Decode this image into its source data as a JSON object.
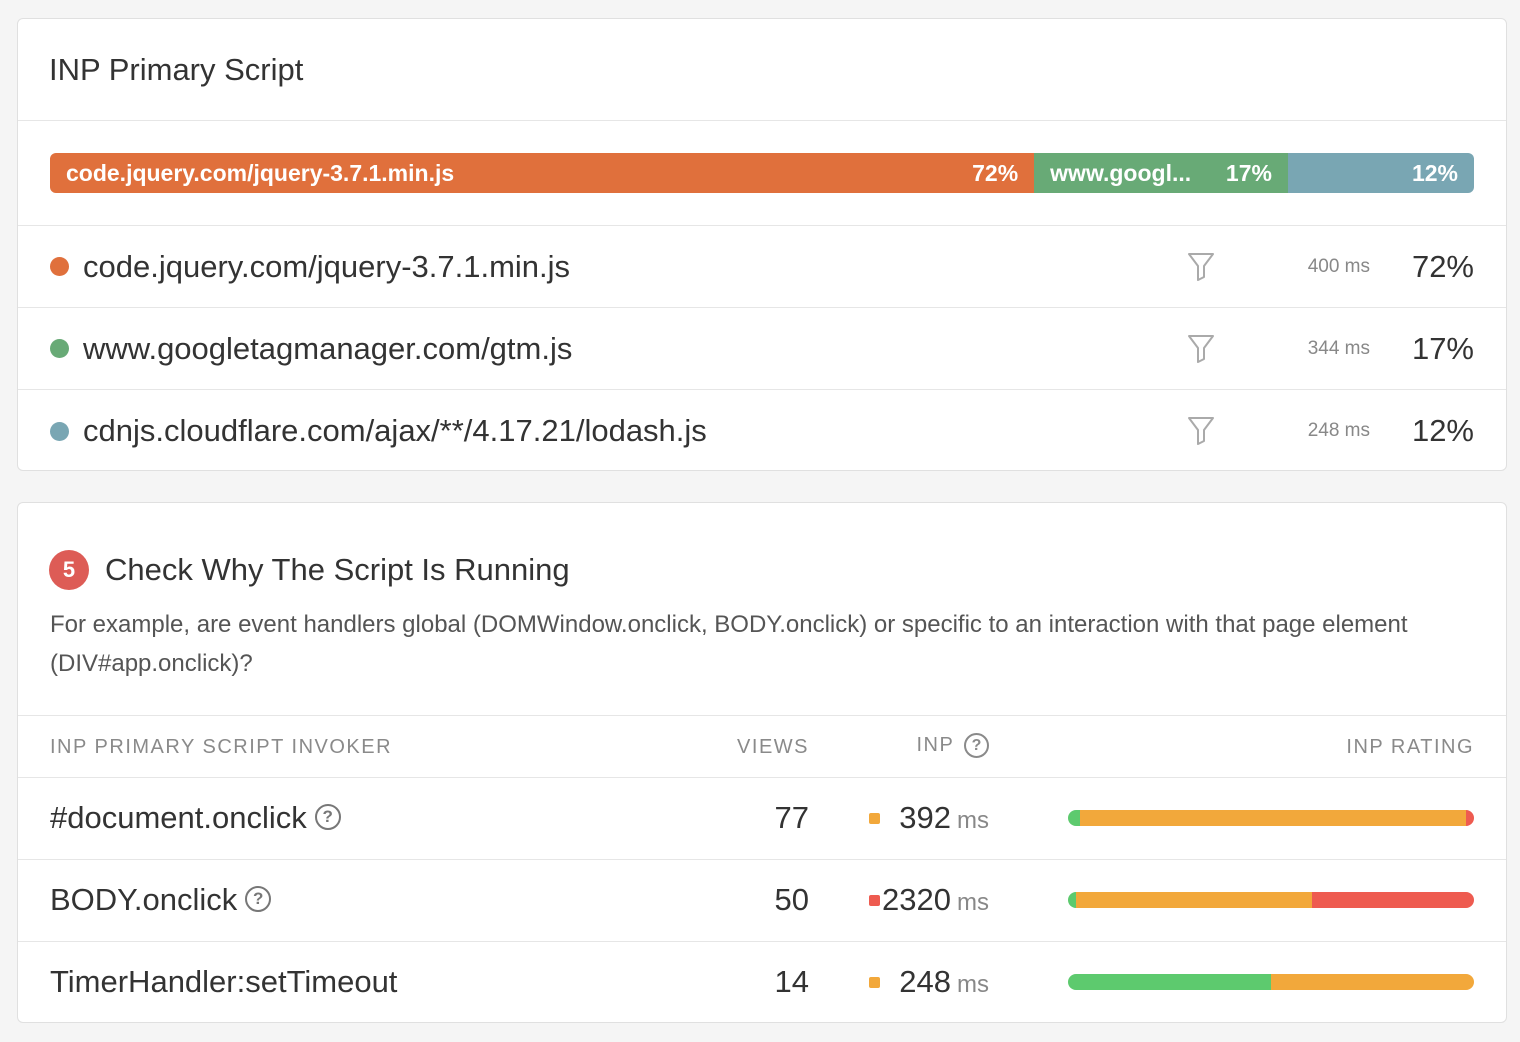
{
  "primary_script": {
    "title": "INP Primary Script",
    "bar": [
      {
        "label": "code.jquery.com/jquery-3.7.1.min.js",
        "pct_label": "72%",
        "share": 0.717,
        "color": "#e0703c"
      },
      {
        "label": "www.googl...",
        "pct_label": "17%",
        "share": 0.167,
        "color": "#68aa76"
      },
      {
        "label": "",
        "pct_label": "12%",
        "share": 0.116,
        "color": "#79a6b3"
      }
    ],
    "rows": [
      {
        "name": "code.jquery.com/jquery-3.7.1.min.js",
        "color": "#e0703c",
        "ms": "400 ms",
        "pct": "72%",
        "icon": "filter-icon"
      },
      {
        "name": "www.googletagmanager.com/gtm.js",
        "color": "#68aa76",
        "ms": "344 ms",
        "pct": "17%",
        "icon": "filter-icon"
      },
      {
        "name": "cdnjs.cloudflare.com/ajax/**/4.17.21/lodash.js",
        "color": "#79a6b3",
        "ms": "248 ms",
        "pct": "12%",
        "icon": "filter-icon"
      }
    ]
  },
  "step": {
    "number": "5",
    "title": "Check Why The Script Is Running",
    "description": "For example, are event handlers global (DOMWindow.onclick, BODY.onclick) or specific to an interaction with that page element (DIV#app.onclick)?",
    "badge_color": "#dd5c56"
  },
  "table": {
    "headers": {
      "invoker": "INP PRIMARY SCRIPT INVOKER",
      "views": "VIEWS",
      "inp": "INP",
      "inp_help": "?",
      "rating": "INP RATING"
    },
    "rows": [
      {
        "invoker": "#document.onclick",
        "has_help": true,
        "views": "77",
        "inp": "392",
        "unit": "ms",
        "status_color": "#f2a83b",
        "rating": {
          "good": 0.03,
          "ni": 0.95,
          "poor": 0.02
        }
      },
      {
        "invoker": "BODY.onclick",
        "has_help": true,
        "views": "50",
        "inp": "2320",
        "unit": "ms",
        "status_color": "#ee5b50",
        "rating": {
          "good": 0.02,
          "ni": 0.58,
          "poor": 0.4
        }
      },
      {
        "invoker": "TimerHandler:setTimeout",
        "has_help": false,
        "views": "14",
        "inp": "248",
        "unit": "ms",
        "status_color": "#f2a83b",
        "rating": {
          "good": 0.5,
          "ni": 0.5,
          "poor": 0.0
        }
      }
    ],
    "help_glyph": "?"
  },
  "colors": {
    "good": "#5dca6e",
    "needs_improvement": "#f2a83b",
    "poor": "#ee5b50"
  }
}
